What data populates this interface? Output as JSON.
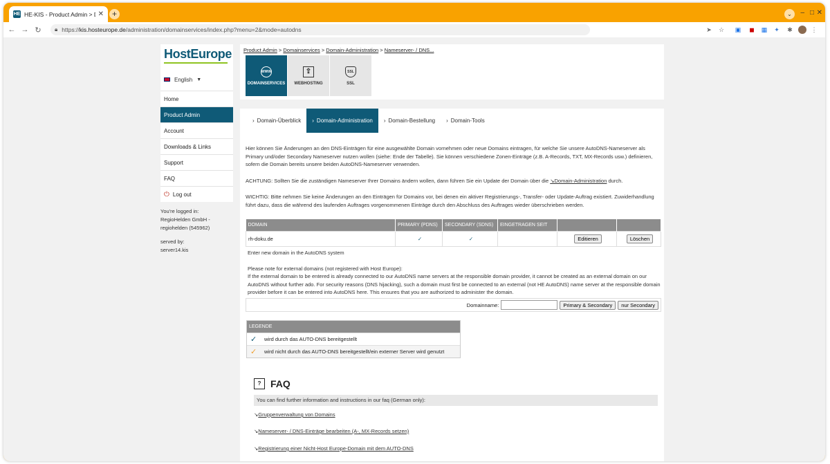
{
  "browser": {
    "tab_title": "HE-KIS - Product Admin > Do...",
    "tab_favicon": "HE",
    "new_tab_label": "+",
    "url_host": "kis.hosteurope.de",
    "url_prefix": "https://",
    "url_path": "/administration/domainservices/index.php?menu=2&mode=autodns"
  },
  "sidebar": {
    "logo": "HostEurope",
    "language": "English",
    "items": [
      {
        "label": "Home"
      },
      {
        "label": "Product Admin"
      },
      {
        "label": "Account"
      },
      {
        "label": "Downloads & Links"
      },
      {
        "label": "Support"
      },
      {
        "label": "FAQ"
      },
      {
        "label": "Log out"
      }
    ],
    "logged_in_label": "You're logged in:",
    "account_line1": "RegioHelden GmbH -",
    "account_line2": "regiohelden (545962)",
    "served_by_label": "served by:",
    "server": "server14.kis"
  },
  "breadcrumb": {
    "items": [
      "Product Admin",
      "Domainservices",
      "Domain-Administration",
      "Nameserver- / DNS..."
    ],
    "separator": ">"
  },
  "services": [
    {
      "label": "DOMAINSERVICES",
      "icon": "www-globe-icon",
      "glyph": "WWW"
    },
    {
      "label": "WEBHOSTING",
      "icon": "webhosting-icon",
      "glyph": "⇪"
    },
    {
      "label": "SSL",
      "icon": "ssl-shield-icon",
      "glyph": "SSL"
    }
  ],
  "subnav": [
    "Domain-Überblick",
    "Domain-Administration",
    "Domain-Bestellung",
    "Domain-Tools"
  ],
  "intro": "Hier können Sie Änderungen an den DNS-Einträgen für eine ausgewählte Domain vornehmen oder neue Domains eintragen, für welche Sie unsere AutoDNS-Nameserver als Primary und/oder Secondary Nameserver nutzen wollen (siehe: Ende der Tabelle). Sie können verschiedene Zonen-Einträge (z.B. A-Records, TXT, MX-Records usw.) definieren, sofern die Domain bereits unsere beiden AutoDNS-Nameserver verwenden.",
  "attention_prefix": "ACHTUNG: Sollten Sie die zuständigen Nameserver Ihrer Domains ändern wollen, dann führen Sie ein Update der Domain über die ",
  "attention_link": "↘Domain-Administration",
  "attention_suffix": " durch.",
  "warning": "WICHTIG: Bitte nehmen Sie keine Änderungen an den Einträgen für Domains vor, bei denen ein aktiver Registrierungs-, Transfer- oder Update-Auftrag existiert. Zuwiderhandlung führt dazu, dass die während des laufenden Auftrages vorgenommenen Einträge durch den Abschluss des Auftrages wieder überschrieben werden.",
  "table": {
    "headers": [
      "DOMAIN",
      "PRIMARY (PDNS)",
      "SECONDARY (SDNS)",
      "EINGETRAGEN SEIT",
      "",
      ""
    ],
    "rows": [
      {
        "domain": "rh-doku.de",
        "primary": "✓",
        "secondary": "✓",
        "since": "",
        "edit": "Editieren",
        "delete": "Löschen"
      }
    ]
  },
  "new_domain_text": "Enter new domain in the AutoDNS system",
  "external_note_title": "Please note for external domains (not registered with Host Europe):",
  "external_note": "If the external domain to be entered is already connected to our AutoDNS name servers at the responsible domain provider, it cannot be created as an external domain on our AutoDNS without further ado. For security reasons (DNS hijacking), such a domain must first be connected to an external (not HE AutoDNS) name server at the responsible domain provider before it can be entered into AutoDNS here. This ensures that you are authorized to administer the domain.",
  "domain_form": {
    "label": "Domainname:",
    "input_value": "",
    "btn_primary": "Primary & Secondary",
    "btn_secondary": "nur Secondary"
  },
  "legend": {
    "title": "LEGENDE",
    "rows": [
      {
        "text": "wird durch das AUTO-DNS bereitgestellt",
        "color": "#0f5a77"
      },
      {
        "text": "wird nicht durch das AUTO-DNS bereitgestellt/ein externer Server wird genutzt",
        "color": "#f0a030"
      }
    ]
  },
  "faq": {
    "title": "FAQ",
    "icon_glyph": "?",
    "intro": "You can find further information and instructions in our faq (German only):",
    "links": [
      "Gruppenverwaltung von Domains",
      "Nameserver- / DNS-Einträge bearbeiten (A-, MX-Records setzen)",
      "Registrierung einer Nicht-Host Europe-Domain mit dem AUTO-DNS"
    ],
    "link_arrow": "↘"
  },
  "colors": {
    "accent": "#0f5a77",
    "browser_frame": "#f9a200",
    "logo_green": "#8ec31f"
  }
}
